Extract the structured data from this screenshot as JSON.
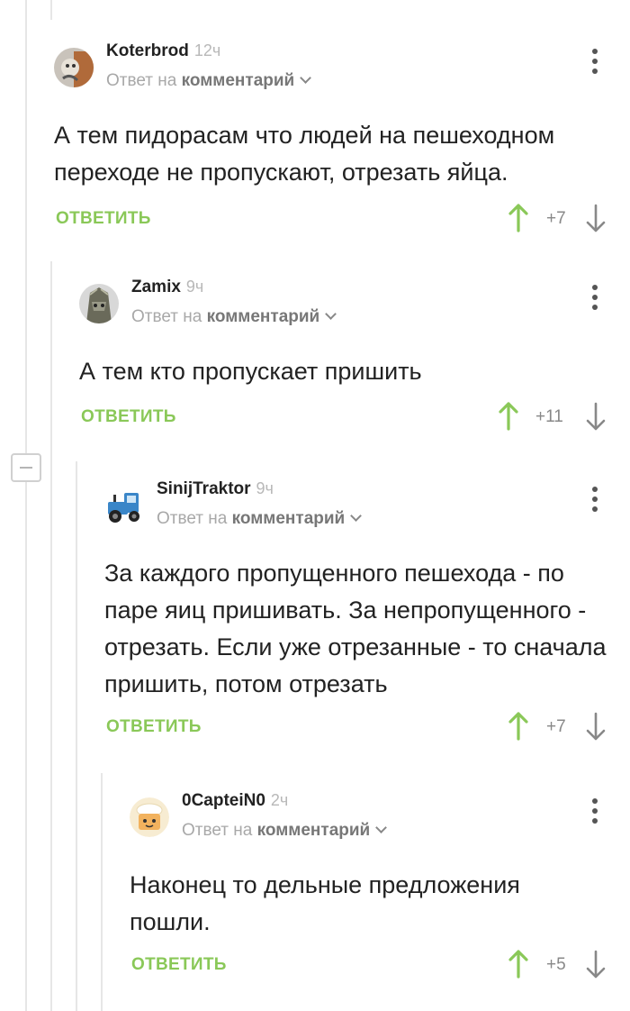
{
  "action_label": "ОТВЕТИТЬ",
  "reply_prefix": "Ответ на",
  "reply_target": "комментарий",
  "comments": [
    {
      "author": "Koterbrod",
      "time": "12ч",
      "text": "А тем пидорасам что людей на пешеходном переходе не пропускают, отрезать яйца.",
      "score": "+7"
    },
    {
      "author": "Zamix",
      "time": "9ч",
      "text": "А тем кто пропускает пришить",
      "score": "+11"
    },
    {
      "author": "SinijTraktor",
      "time": "9ч",
      "text": "За каждого пропущенного пешехода - по паре яиц пришивать. За непропущенного - отрезать. Если уже отрезанные - то сначала пришить, потом отрезать",
      "score": "+7"
    },
    {
      "author": "0CapteiN0",
      "time": "2ч",
      "text": "Наконец то дельные предложения пошли.",
      "score": "+5"
    }
  ],
  "colors": {
    "accent": "#8ac858",
    "thread_line": "#e6e6e6",
    "muted": "#a8a8a8"
  }
}
